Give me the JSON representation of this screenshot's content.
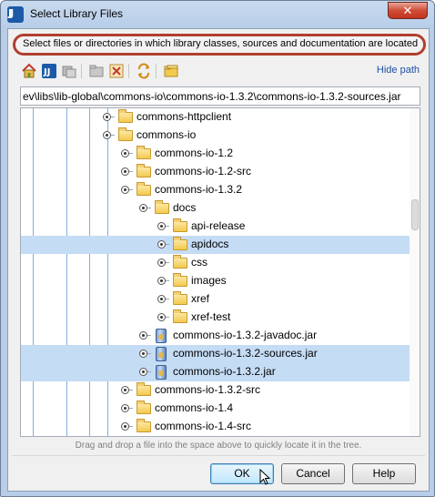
{
  "window": {
    "title": "Select Library Files",
    "close_glyph": "✕"
  },
  "hint": "Select files or directories in which library classes, sources and documentation are located",
  "toolbar": {
    "icons": [
      "home-icon",
      "project-icon",
      "module-icon",
      "new-folder-icon",
      "delete-icon",
      "refresh-icon",
      "show-folders-icon"
    ],
    "hide_path_label": "Hide path"
  },
  "path_value": "ev\\libs\\lib-global\\commons-io\\commons-io-1.3.2\\commons-io-1.3.2-sources.jar",
  "tree": {
    "nodes": [
      {
        "label": "commons-httpclient",
        "type": "folder",
        "level": 0,
        "selected": false
      },
      {
        "label": "commons-io",
        "type": "folder",
        "level": 0,
        "selected": false
      },
      {
        "label": "commons-io-1.2",
        "type": "folder",
        "level": 1,
        "selected": false
      },
      {
        "label": "commons-io-1.2-src",
        "type": "folder",
        "level": 1,
        "selected": false
      },
      {
        "label": "commons-io-1.3.2",
        "type": "folder",
        "level": 1,
        "selected": false
      },
      {
        "label": "docs",
        "type": "folder",
        "level": 2,
        "selected": false
      },
      {
        "label": "api-release",
        "type": "folder",
        "level": 3,
        "selected": false
      },
      {
        "label": "apidocs",
        "type": "folder",
        "level": 3,
        "selected": true
      },
      {
        "label": "css",
        "type": "folder",
        "level": 3,
        "selected": false
      },
      {
        "label": "images",
        "type": "folder",
        "level": 3,
        "selected": false
      },
      {
        "label": "xref",
        "type": "folder",
        "level": 3,
        "selected": false
      },
      {
        "label": "xref-test",
        "type": "folder",
        "level": 3,
        "selected": false
      },
      {
        "label": "commons-io-1.3.2-javadoc.jar",
        "type": "jar",
        "level": 2,
        "selected": false
      },
      {
        "label": "commons-io-1.3.2-sources.jar",
        "type": "jar",
        "level": 2,
        "selected": true
      },
      {
        "label": "commons-io-1.3.2.jar",
        "type": "jar",
        "level": 2,
        "selected": true
      },
      {
        "label": "commons-io-1.3.2-src",
        "type": "folder",
        "level": 1,
        "selected": false
      },
      {
        "label": "commons-io-1.4",
        "type": "folder",
        "level": 1,
        "selected": false
      },
      {
        "label": "commons-io-1.4-src",
        "type": "folder",
        "level": 1,
        "selected": false
      }
    ]
  },
  "drag_hint": "Drag and drop a file into the space above to quickly locate it in the tree.",
  "buttons": {
    "ok": "OK",
    "cancel": "Cancel",
    "help": "Help"
  }
}
